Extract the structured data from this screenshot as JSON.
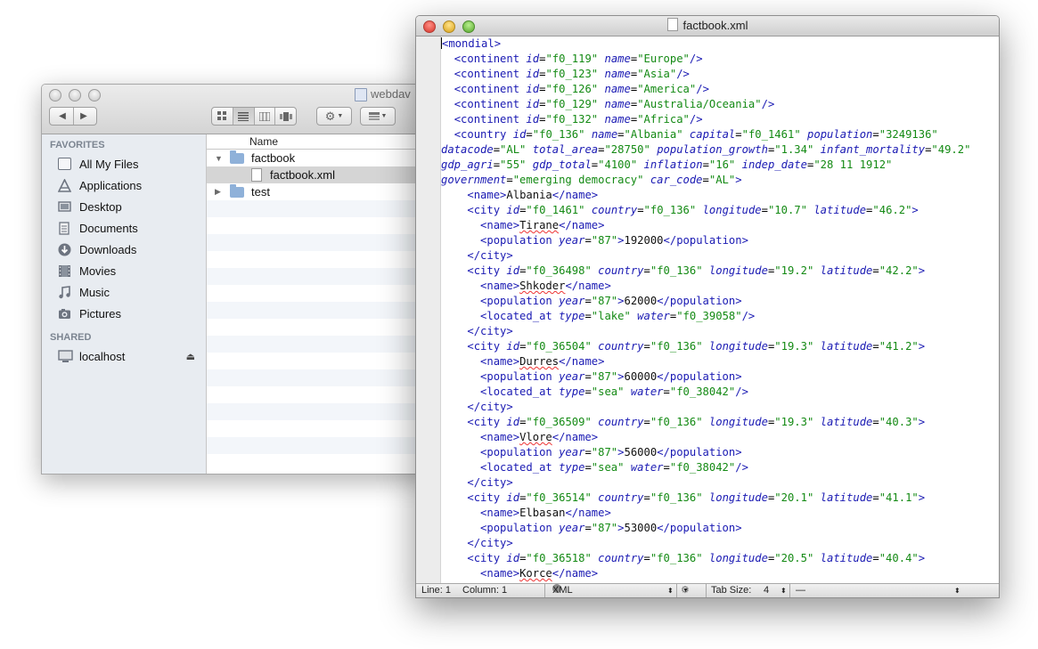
{
  "finder": {
    "title": "webdav",
    "nav_back": "◀",
    "nav_forward": "▶",
    "favorites_header": "FAVORITES",
    "favorites": [
      {
        "label": "All My Files",
        "icon": "all-files-icon"
      },
      {
        "label": "Applications",
        "icon": "applications-icon"
      },
      {
        "label": "Desktop",
        "icon": "desktop-icon"
      },
      {
        "label": "Documents",
        "icon": "documents-icon"
      },
      {
        "label": "Downloads",
        "icon": "downloads-icon"
      },
      {
        "label": "Movies",
        "icon": "movies-icon"
      },
      {
        "label": "Music",
        "icon": "music-icon"
      },
      {
        "label": "Pictures",
        "icon": "pictures-icon"
      }
    ],
    "shared_header": "SHARED",
    "shared": [
      {
        "label": "localhost",
        "icon": "computer-icon",
        "eject": "⏏"
      }
    ],
    "column_name": "Name",
    "files": [
      {
        "name": "factbook",
        "type": "folder",
        "expanded": true,
        "disclosure": "▼"
      },
      {
        "name": "factbook.xml",
        "type": "file",
        "selected": true
      },
      {
        "name": "test",
        "type": "folder",
        "expanded": false,
        "disclosure": "▶"
      }
    ]
  },
  "editor": {
    "title": "factbook.xml",
    "statusbar": {
      "line": "Line: 1",
      "column": "Column: 1",
      "syntax": "XML",
      "tab_size_label": "Tab Size:",
      "tab_size": "4",
      "function_menu": "—"
    },
    "lines": [
      "<mondial>",
      "  <continent id=\"f0_119\" name=\"Europe\"/>",
      "  <continent id=\"f0_123\" name=\"Asia\"/>",
      "  <continent id=\"f0_126\" name=\"America\"/>",
      "  <continent id=\"f0_129\" name=\"Australia/Oceania\"/>",
      "  <continent id=\"f0_132\" name=\"Africa\"/>",
      "  <country id=\"f0_136\" name=\"Albania\" capital=\"f0_1461\" population=\"3249136\"",
      "datacode=\"AL\" total_area=\"28750\" population_growth=\"1.34\" infant_mortality=\"49.2\"",
      "gdp_agri=\"55\" gdp_total=\"4100\" inflation=\"16\" indep_date=\"28 11 1912\"",
      "government=\"emerging democracy\" car_code=\"AL\">",
      "    <name>Albania</name>",
      "    <city id=\"f0_1461\" country=\"f0_136\" longitude=\"10.7\" latitude=\"46.2\">",
      "      <name>Tirane</name>",
      "      <population year=\"87\">192000</population>",
      "    </city>",
      "    <city id=\"f0_36498\" country=\"f0_136\" longitude=\"19.2\" latitude=\"42.2\">",
      "      <name>Shkoder</name>",
      "      <population year=\"87\">62000</population>",
      "      <located_at type=\"lake\" water=\"f0_39058\"/>",
      "    </city>",
      "    <city id=\"f0_36504\" country=\"f0_136\" longitude=\"19.3\" latitude=\"41.2\">",
      "      <name>Durres</name>",
      "      <population year=\"87\">60000</population>",
      "      <located_at type=\"sea\" water=\"f0_38042\"/>",
      "    </city>",
      "    <city id=\"f0_36509\" country=\"f0_136\" longitude=\"19.3\" latitude=\"40.3\">",
      "      <name>Vlore</name>",
      "      <population year=\"87\">56000</population>",
      "      <located_at type=\"sea\" water=\"f0_38042\"/>",
      "    </city>",
      "    <city id=\"f0_36514\" country=\"f0_136\" longitude=\"20.1\" latitude=\"41.1\">",
      "      <name>Elbasan</name>",
      "      <population year=\"87\">53000</population>",
      "    </city>",
      "    <city id=\"f0_36518\" country=\"f0_136\" longitude=\"20.5\" latitude=\"40.4\">",
      "      <name>Korce</name>"
    ],
    "fold_markers": [
      "open",
      "",
      "",
      "",
      "",
      "",
      "open",
      "dot",
      "dot",
      "dot",
      "",
      "open",
      "",
      "",
      "close",
      "open",
      "",
      "",
      "",
      "close",
      "open",
      "",
      "",
      "",
      "close",
      "open",
      "",
      "",
      "",
      "close",
      "open",
      "",
      "",
      "close",
      "open",
      ""
    ],
    "misspelled": [
      "Tirane",
      "Shkoder",
      "Durres",
      "Vlore",
      "Korce"
    ]
  },
  "colors": {
    "xml_tag": "#1a1ab3",
    "xml_attr_value": "#148a14",
    "sidebar_bg": "#e8ecf1",
    "selection": "#d5d5d5"
  }
}
